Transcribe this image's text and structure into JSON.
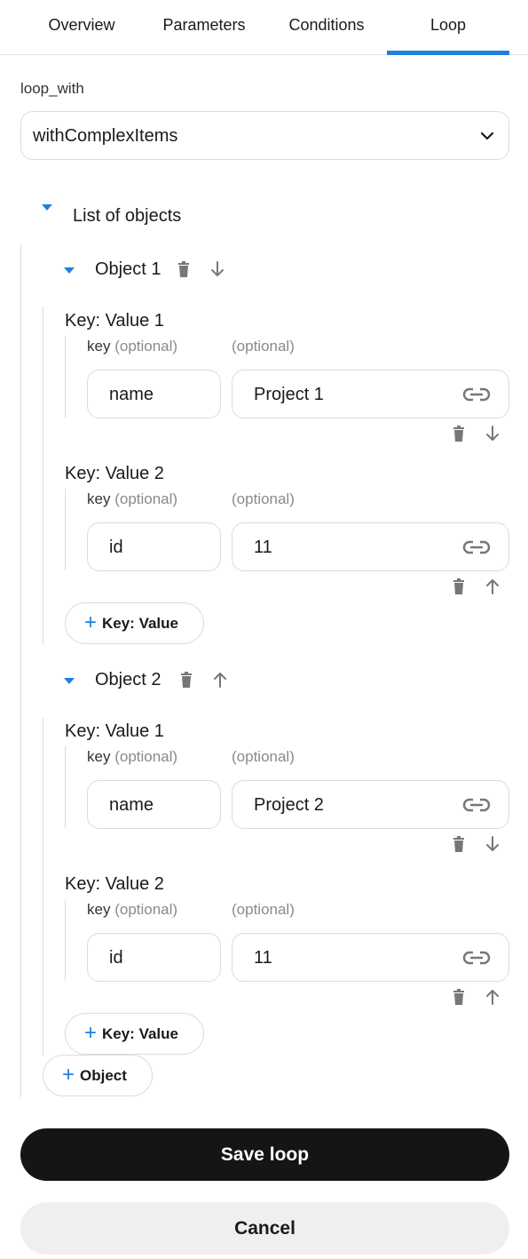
{
  "tabs": [
    {
      "label": "Overview",
      "active": false
    },
    {
      "label": "Parameters",
      "active": false
    },
    {
      "label": "Conditions",
      "active": false
    },
    {
      "label": "Loop",
      "active": true
    }
  ],
  "loop_with": {
    "label": "loop_with",
    "value": "withComplexItems"
  },
  "list": {
    "title": "List of objects",
    "objects": [
      {
        "title": "Object 1",
        "pairs": [
          {
            "title": "Key: Value 1",
            "key_label": "key",
            "key_optional": "(optional)",
            "value_optional": "(optional)",
            "key": "name",
            "value": "Project 1"
          },
          {
            "title": "Key: Value 2",
            "key_label": "key",
            "key_optional": "(optional)",
            "value_optional": "(optional)",
            "key": "id",
            "value": "11"
          }
        ],
        "add_pair_label": "Key: Value"
      },
      {
        "title": "Object 2",
        "pairs": [
          {
            "title": "Key: Value 1",
            "key_label": "key",
            "key_optional": "(optional)",
            "value_optional": "(optional)",
            "key": "name",
            "value": "Project 2"
          },
          {
            "title": "Key: Value 2",
            "key_label": "key",
            "key_optional": "(optional)",
            "value_optional": "(optional)",
            "key": "id",
            "value": "11"
          }
        ],
        "add_pair_label": "Key: Value"
      }
    ],
    "add_object_label": "Object"
  },
  "actions": {
    "save": "Save loop",
    "cancel": "Cancel"
  },
  "colors": {
    "accent": "#1f7fe0",
    "primary_button": "#151515",
    "secondary_button": "#efefef"
  },
  "icons": {
    "delete": "trash-icon",
    "move_down": "arrow-down-icon",
    "move_up": "arrow-up-icon",
    "link": "link-icon",
    "caret": "caret-down-icon",
    "dropdown": "chevron-down-icon",
    "add": "plus-icon"
  }
}
